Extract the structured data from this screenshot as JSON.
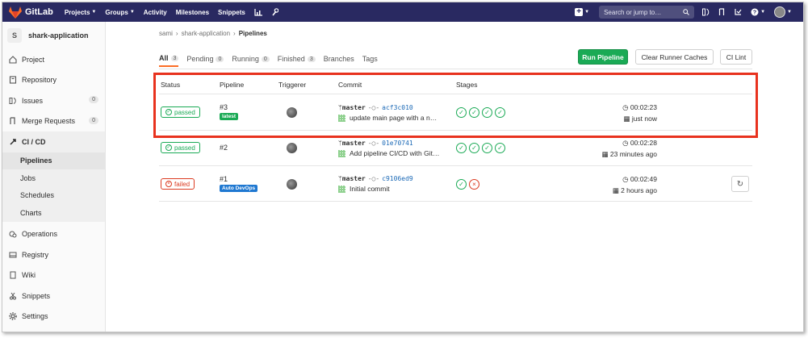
{
  "topnav": {
    "brand": "GitLab",
    "links": [
      "Projects",
      "Groups",
      "Activity",
      "Milestones",
      "Snippets"
    ],
    "search_placeholder": "Search or jump to…"
  },
  "sidebar": {
    "project_avatar": "S",
    "project_name": "shark-application",
    "items": [
      {
        "label": "Project",
        "icon": "home-icon"
      },
      {
        "label": "Repository",
        "icon": "book-icon"
      },
      {
        "label": "Issues",
        "icon": "issues-icon",
        "count": "0"
      },
      {
        "label": "Merge Requests",
        "icon": "merge-request-icon",
        "count": "0"
      },
      {
        "label": "CI / CD",
        "icon": "rocket-icon"
      }
    ],
    "ci_sub": [
      "Pipelines",
      "Jobs",
      "Schedules",
      "Charts"
    ],
    "items_after": [
      {
        "label": "Operations",
        "icon": "cloud-gear-icon"
      },
      {
        "label": "Registry",
        "icon": "disk-icon"
      },
      {
        "label": "Wiki",
        "icon": "book-icon"
      },
      {
        "label": "Snippets",
        "icon": "scissors-icon"
      },
      {
        "label": "Settings",
        "icon": "gear-icon"
      }
    ]
  },
  "breadcrumb": [
    "sami",
    "shark-application",
    "Pipelines"
  ],
  "tabs": [
    {
      "label": "All",
      "count": "3"
    },
    {
      "label": "Pending",
      "count": "0"
    },
    {
      "label": "Running",
      "count": "0"
    },
    {
      "label": "Finished",
      "count": "3"
    },
    {
      "label": "Branches"
    },
    {
      "label": "Tags"
    }
  ],
  "buttons": {
    "run_pipeline": "Run Pipeline",
    "clear_caches": "Clear Runner Caches",
    "ci_lint": "CI Lint"
  },
  "table": {
    "headers": [
      "Status",
      "Pipeline",
      "Triggerer",
      "Commit",
      "Stages"
    ],
    "rows": [
      {
        "status": "passed",
        "id": "#3",
        "tag": "latest",
        "branch": "master",
        "sha": "acf3c010",
        "message": "update main page with a n…",
        "stages": [
          "success",
          "success",
          "success",
          "success"
        ],
        "duration": "00:02:23",
        "finished": "just now"
      },
      {
        "status": "passed",
        "id": "#2",
        "tag": "",
        "branch": "master",
        "sha": "01e70741",
        "message": "Add pipeline CI/CD with Git…",
        "stages": [
          "success",
          "success",
          "success",
          "success"
        ],
        "duration": "00:02:28",
        "finished": "23 minutes ago"
      },
      {
        "status": "failed",
        "id": "#1",
        "tag": "Auto DevOps",
        "branch": "master",
        "sha": "c9106ed9",
        "message": "Initial commit",
        "stages": [
          "success",
          "failed"
        ],
        "duration": "00:02:49",
        "finished": "2 hours ago"
      }
    ]
  },
  "colors": {
    "nav_bg": "#292961",
    "success": "#1aaa55",
    "failed": "#db3b21",
    "highlight": "#e8321e",
    "link": "#1b69b6"
  }
}
